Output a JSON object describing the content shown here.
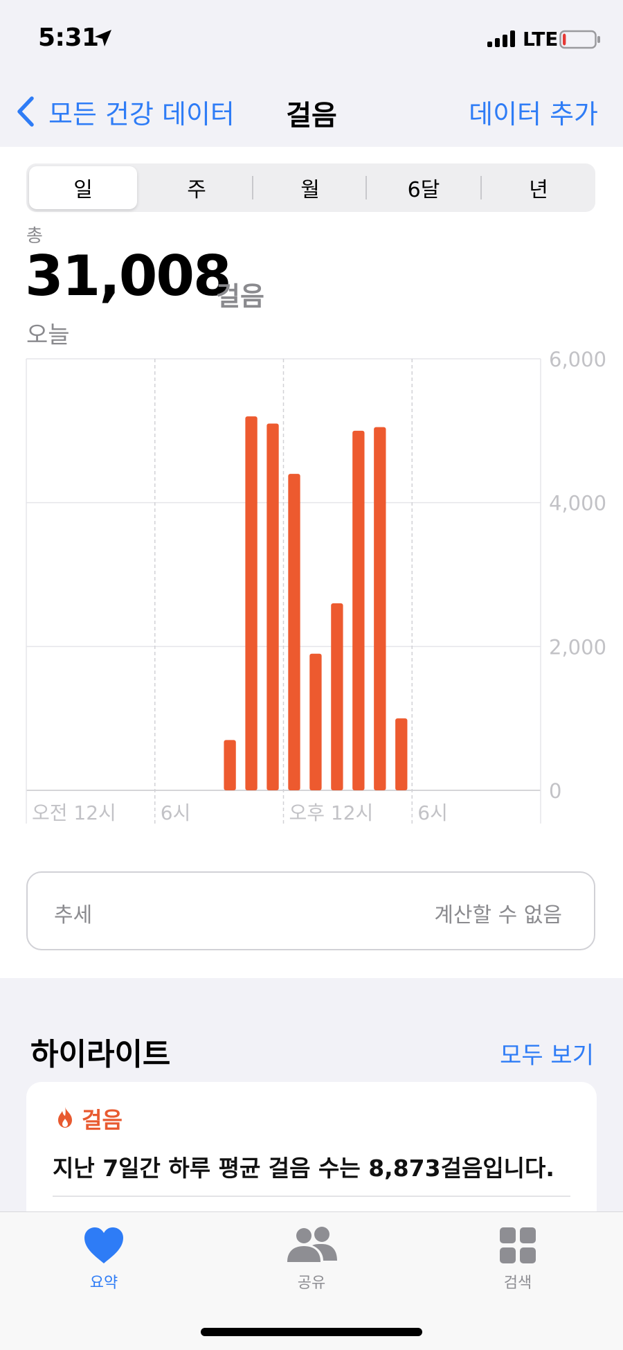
{
  "status_bar": {
    "time": "5:31",
    "network": "LTE",
    "battery_level": 0.1
  },
  "nav": {
    "back_label": "모든 건강 데이터",
    "title": "걸음",
    "action_label": "데이터 추가"
  },
  "segments": {
    "items": [
      "일",
      "주",
      "월",
      "6달",
      "년"
    ],
    "selected": "일"
  },
  "summary": {
    "total_label": "총",
    "total_value": "31,008",
    "unit": "걸음",
    "date_label": "오늘"
  },
  "chart_data": {
    "type": "bar",
    "x": [
      9,
      10,
      11,
      12,
      13,
      14,
      15,
      16,
      17
    ],
    "x_unit": "hour of day",
    "values": [
      700,
      5200,
      5100,
      4400,
      1900,
      2600,
      5000,
      5050,
      1000
    ],
    "xlim": [
      0,
      24
    ],
    "ylim": [
      0,
      6000
    ],
    "yticks": [
      {
        "value": 0,
        "label": "0"
      },
      {
        "value": 2000,
        "label": "2,000"
      },
      {
        "value": 4000,
        "label": "4,000"
      },
      {
        "value": 6000,
        "label": "6,000"
      }
    ],
    "xticks": [
      {
        "hour": 0,
        "label": "오전 12시"
      },
      {
        "hour": 6,
        "label": "6시"
      },
      {
        "hour": 12,
        "label": "오후 12시"
      },
      {
        "hour": 18,
        "label": "6시"
      }
    ],
    "color": "#ed5a2f",
    "grid": true
  },
  "trend": {
    "label": "추세",
    "value": "계산할 수 없음"
  },
  "highlights": {
    "title": "하이라이트",
    "see_all": "모두 보기",
    "card": {
      "category": "걸음",
      "text": "지난 7일간 하루 평균 걸음 수는 8,873걸음입니다."
    }
  },
  "tab_bar": {
    "tabs": [
      {
        "label": "요약",
        "icon": "heart-icon",
        "active": true
      },
      {
        "label": "공유",
        "icon": "people-icon",
        "active": false
      },
      {
        "label": "검색",
        "icon": "grid-icon",
        "active": false
      }
    ]
  },
  "colors": {
    "accent": "#2e7cf6",
    "bar": "#ed5a2f",
    "highlight_category": "#e85a30"
  }
}
